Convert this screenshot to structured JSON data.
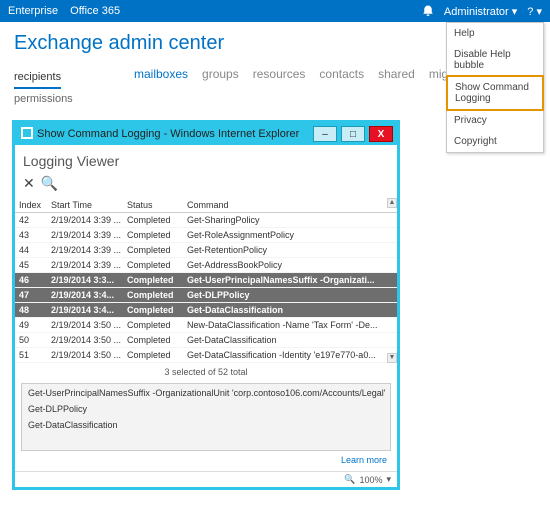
{
  "topbar": {
    "left": [
      "Enterprise",
      "Office 365"
    ],
    "admin_label": "Administrator",
    "help_glyph": "?"
  },
  "page_title": "Exchange admin center",
  "sidebar": {
    "items": [
      {
        "label": "recipients",
        "active": true
      },
      {
        "label": "permissions",
        "active": false
      }
    ]
  },
  "tabs": {
    "items": [
      {
        "label": "mailboxes",
        "active": true
      },
      {
        "label": "groups",
        "active": false
      },
      {
        "label": "resources",
        "active": false
      },
      {
        "label": "contacts",
        "active": false
      },
      {
        "label": "shared",
        "active": false
      },
      {
        "label": "migration",
        "active": false
      }
    ]
  },
  "help_menu": {
    "items": [
      {
        "label": "Help",
        "highlight": false
      },
      {
        "label": "Disable Help bubble",
        "highlight": false
      },
      {
        "label": "Show Command Logging",
        "highlight": true
      },
      {
        "label": "Privacy",
        "highlight": false
      },
      {
        "label": "Copyright",
        "highlight": false
      }
    ]
  },
  "popup": {
    "title": "Show Command Logging - Windows Internet Explorer",
    "viewer_title": "Logging Viewer",
    "columns": [
      "Index",
      "Start Time",
      "Status",
      "Command"
    ],
    "rows": [
      {
        "index": "42",
        "time": "2/19/2014 3:39 ...",
        "status": "Completed",
        "cmd": "Get-SharingPolicy",
        "sel": false
      },
      {
        "index": "43",
        "time": "2/19/2014 3:39 ...",
        "status": "Completed",
        "cmd": "Get-RoleAssignmentPolicy",
        "sel": false
      },
      {
        "index": "44",
        "time": "2/19/2014 3:39 ...",
        "status": "Completed",
        "cmd": "Get-RetentionPolicy",
        "sel": false
      },
      {
        "index": "45",
        "time": "2/19/2014 3:39 ...",
        "status": "Completed",
        "cmd": "Get-AddressBookPolicy",
        "sel": false
      },
      {
        "index": "46",
        "time": "2/19/2014 3:3...",
        "status": "Completed",
        "cmd": "Get-UserPrincipalNamesSuffix -Organizati...",
        "sel": true
      },
      {
        "index": "47",
        "time": "2/19/2014 3:4...",
        "status": "Completed",
        "cmd": "Get-DLPPolicy",
        "sel": true
      },
      {
        "index": "48",
        "time": "2/19/2014 3:4...",
        "status": "Completed",
        "cmd": "Get-DataClassification",
        "sel": true
      },
      {
        "index": "49",
        "time": "2/19/2014 3:50 ...",
        "status": "Completed",
        "cmd": "New-DataClassification -Name 'Tax Form' -De...",
        "sel": false
      },
      {
        "index": "50",
        "time": "2/19/2014 3:50 ...",
        "status": "Completed",
        "cmd": "Get-DataClassification",
        "sel": false
      },
      {
        "index": "51",
        "time": "2/19/2014 3:50 ...",
        "status": "Completed",
        "cmd": "Get-DataClassification -Identity 'e197e770-a0...",
        "sel": false
      }
    ],
    "status_count": "3 selected of 52 total",
    "detail_lines": [
      "Get-UserPrincipalNamesSuffix -OrganizationalUnit 'corp.contoso106.com/Accounts/Legal'",
      "Get-DLPPolicy",
      "Get-DataClassification"
    ],
    "learn_more": "Learn more",
    "zoom": "100%"
  }
}
